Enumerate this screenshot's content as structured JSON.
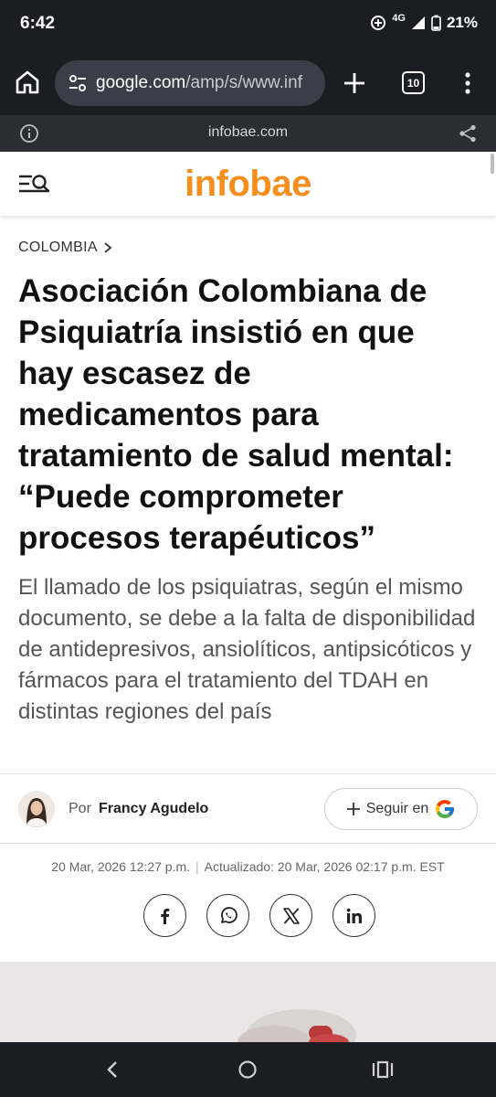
{
  "status_bar": {
    "time": "6:42",
    "network": "4G",
    "battery": "21%"
  },
  "browser": {
    "url_host": "google.com",
    "url_rest": "/amp/s/www.inf",
    "tab_count": "10",
    "site_domain": "infobae.com"
  },
  "site": {
    "logo": "infobae",
    "brand_color": "#f68e1e"
  },
  "article": {
    "section": "COLOMBIA",
    "headline": "Asociación Colombiana de Psiquiatría insistió en que hay escasez de medicamentos para tratamiento de salud mental: “Puede comprometer procesos terapéuticos”",
    "subhead": "El llamado de los psiquiatras, según el mismo documento, se debe a la falta de disponibilidad de antidepresivos, ansiolíticos, antipsicóticos y fármacos para el tratamiento del TDAH en distintas regiones del país",
    "author_prefix": "Por",
    "author_name": "Francy Agudelo",
    "follow_label": "Seguir en",
    "published": "20 Mar, 2026 12:27 p.m.",
    "updated": "Actualizado: 20 Mar, 2026 02:17 p.m. EST"
  },
  "share_icons": [
    "facebook-icon",
    "whatsapp-icon",
    "x-icon",
    "linkedin-icon"
  ]
}
